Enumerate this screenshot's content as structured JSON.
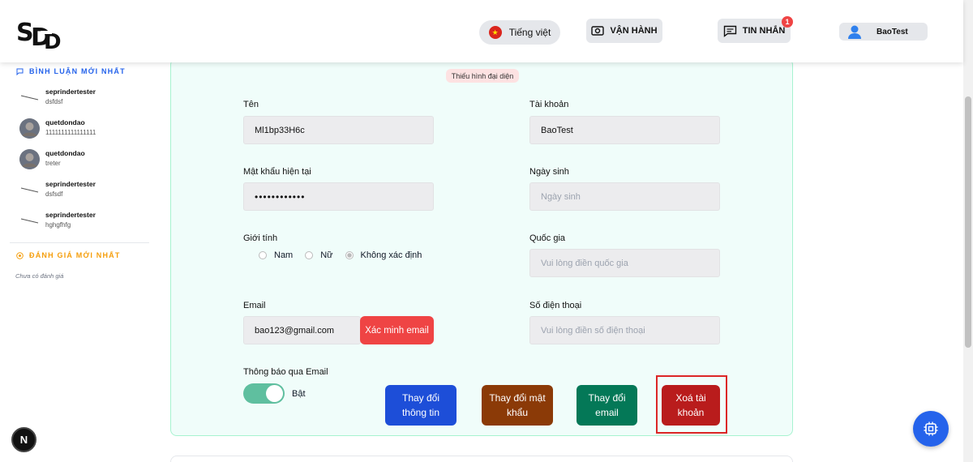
{
  "header": {
    "logo_text": "SDD",
    "language_label": "Tiếng việt",
    "operations_label": "VẬN HÀNH",
    "messages_label": "TIN NHẮN",
    "messages_badge": "1",
    "username": "BaoTest"
  },
  "sidebar": {
    "latest_comments_title": "BÌNH LUẬN MỚI NHẤT",
    "comments": [
      {
        "name": "seprindertester",
        "text": "dsfdsf",
        "avatar": "line"
      },
      {
        "name": "quetdondao",
        "text": "1111111111111111",
        "avatar": "photo"
      },
      {
        "name": "quetdondao",
        "text": "treter",
        "avatar": "photo"
      },
      {
        "name": "seprindertester",
        "text": "dsfsdf",
        "avatar": "line"
      },
      {
        "name": "seprindertester",
        "text": "hghgfhfg",
        "avatar": "line"
      }
    ],
    "latest_reviews_title": "ĐÁNH GIÁ MỚI NHẤT",
    "no_reviews_text": "Chưa có đánh giá"
  },
  "form": {
    "avatar_missing": "Thiếu hình đại diện",
    "name_label": "Tên",
    "name_value": "Ml1bp33H6c",
    "account_label": "Tài khoản",
    "account_value": "BaoTest",
    "current_password_label": "Mật khẩu hiện tại",
    "current_password_value": "••••••••••••",
    "birthday_label": "Ngày sinh",
    "birthday_placeholder": "Ngày sinh",
    "gender_label": "Giới tính",
    "gender_options": [
      "Nam",
      "Nữ",
      "Không xác định"
    ],
    "gender_selected": "Không xác định",
    "country_label": "Quốc gia",
    "country_placeholder": "Vui lòng điền quốc gia",
    "email_label": "Email",
    "email_value": "bao123@gmail.com",
    "verify_email_label": "Xác minh email",
    "phone_label": "Số điện thoại",
    "phone_placeholder": "Vui lòng điền số điện thoại",
    "email_notify_label": "Thông báo qua Email",
    "email_notify_state": "Bật",
    "change_info_label": "Thay đổi thông tin",
    "change_password_label": "Thay đổi mật khẩu",
    "change_email_label": "Thay đổi email",
    "delete_account_label": "Xoá tài khoản"
  },
  "floating": {
    "n_label": "N"
  },
  "colors": {
    "accent_blue": "#1d4ed8",
    "danger": "#b91c1c",
    "form_bg": "#f0fdfa",
    "toggle_on": "#5fbf9f"
  }
}
